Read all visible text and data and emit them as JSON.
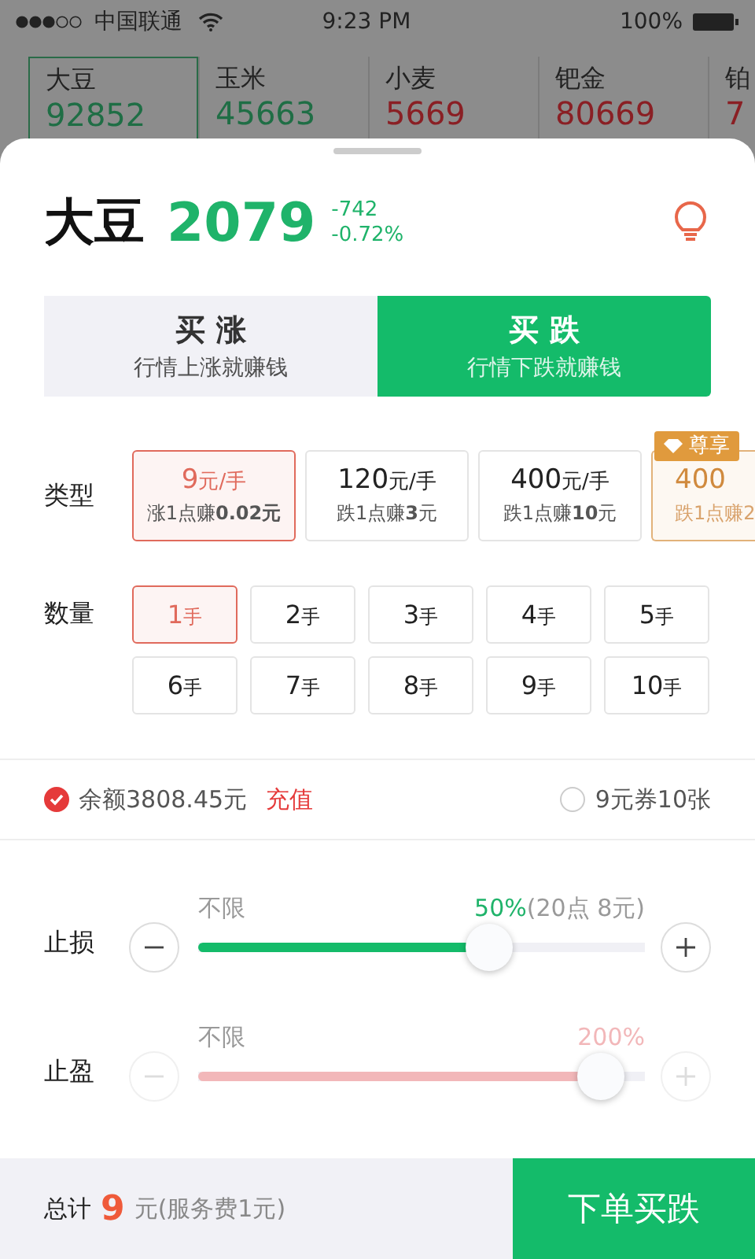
{
  "status_bar": {
    "carrier": "中国联通",
    "time": "9:23 PM",
    "battery": "100%"
  },
  "ticker": [
    {
      "name": "大豆",
      "price": "92852",
      "color": "#1f6e45",
      "selected": true
    },
    {
      "name": "玉米",
      "price": "45663",
      "color": "#1f6e45",
      "selected": false
    },
    {
      "name": "小麦",
      "price": "5669",
      "color": "#8a1f24",
      "selected": false
    },
    {
      "name": "钯金",
      "price": "80669",
      "color": "#8a1f24",
      "selected": false
    },
    {
      "name": "铂",
      "price": "7",
      "color": "#8a1f24",
      "selected": false
    }
  ],
  "product": {
    "name": "大豆",
    "price": "2079",
    "change": "-742",
    "change_pct": "-0.72%"
  },
  "direction_tabs": [
    {
      "title": "买 涨",
      "subtitle": "行情上涨就赚钱",
      "selected": false
    },
    {
      "title": "买 跌",
      "subtitle": "行情下跌就赚钱",
      "selected": true
    }
  ],
  "type": {
    "label": "类型",
    "options": [
      {
        "kind": "normal",
        "price": "9",
        "unit": "元/手",
        "note": "涨1点赚**0.02元**",
        "selected": true
      },
      {
        "kind": "normal",
        "price": "120",
        "unit": "元/手",
        "note": "跌1点赚**3**元",
        "selected": false
      },
      {
        "kind": "normal",
        "price": "400",
        "unit": "元/手",
        "note": "跌1点赚**10**元",
        "selected": false
      },
      {
        "kind": "premium",
        "badge": "尊享",
        "price": "400",
        "note": "跌1点赚2",
        "selected": false
      }
    ]
  },
  "quantity": {
    "label": "数量",
    "options": [
      {
        "number": "1",
        "unit": "手",
        "selected": true
      },
      {
        "number": "2",
        "unit": "手",
        "selected": false
      },
      {
        "number": "3",
        "unit": "手",
        "selected": false
      },
      {
        "number": "4",
        "unit": "手",
        "selected": false
      },
      {
        "number": "5",
        "unit": "手",
        "selected": false
      },
      {
        "number": "6",
        "unit": "手",
        "selected": false
      },
      {
        "number": "7",
        "unit": "手",
        "selected": false
      },
      {
        "number": "8",
        "unit": "手",
        "selected": false
      },
      {
        "number": "9",
        "unit": "手",
        "selected": false
      },
      {
        "number": "10",
        "unit": "手",
        "selected": false
      }
    ]
  },
  "balance": {
    "checked": true,
    "text": "余额3808.45元",
    "link": "充值"
  },
  "coupon": {
    "checked": false,
    "text": "9元券10张"
  },
  "sliders": [
    {
      "label": "止损",
      "min_label": "不限",
      "reading": "50%",
      "reading_note": "(20点 8元)",
      "level": 0.67,
      "disabled": false
    },
    {
      "label": "止盈",
      "min_label": "不限",
      "reading": "200%",
      "level": 0.95,
      "disabled": true
    }
  ],
  "footer": {
    "label": "总计",
    "amount": "9",
    "note": "元(服务费1元)",
    "button": "下单买跌"
  }
}
